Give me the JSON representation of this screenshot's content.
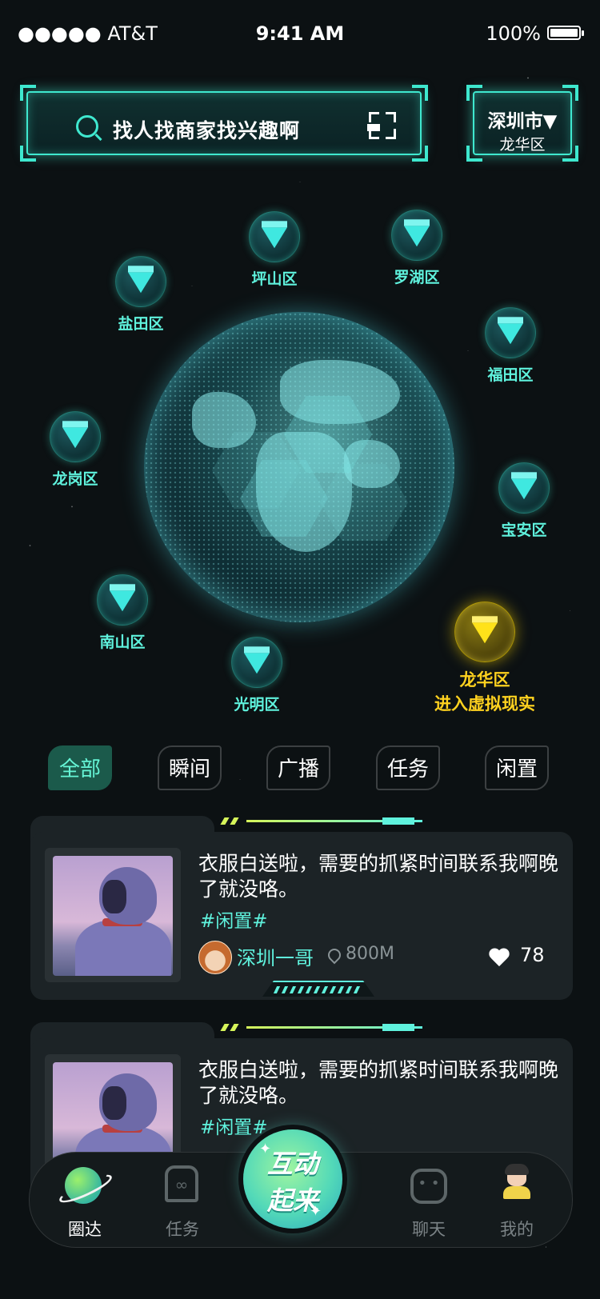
{
  "status_bar": {
    "carrier": "●●●●● AT&T",
    "time": "9:41 AM",
    "battery": "100%",
    "battery_level": 1.0
  },
  "search": {
    "placeholder": "找人找商家找兴趣啊"
  },
  "location": {
    "city": "深圳市▼",
    "district": "龙华区"
  },
  "districts": [
    {
      "name": "盐田区"
    },
    {
      "name": "坪山区"
    },
    {
      "name": "罗湖区"
    },
    {
      "name": "福田区"
    },
    {
      "name": "龙岗区"
    },
    {
      "name": "宝安区"
    },
    {
      "name": "南山区"
    },
    {
      "name": "光明区"
    }
  ],
  "active_district": {
    "name": "龙华区",
    "action": "进入虚拟现实"
  },
  "tabs": [
    {
      "label": "全部",
      "active": true
    },
    {
      "label": "瞬间"
    },
    {
      "label": "广播"
    },
    {
      "label": "任务"
    },
    {
      "label": "闲置"
    }
  ],
  "posts": [
    {
      "title": "衣服白送啦，需要的抓紧时间联系我啊晚了就没咯。",
      "tag": "#闲置#",
      "author": "深圳一哥",
      "distance": "800M",
      "likes": "78"
    },
    {
      "title": "衣服白送啦，需要的抓紧时间联系我啊晚了就没咯。",
      "tag": "#闲置#"
    }
  ],
  "nav": {
    "items": [
      {
        "label": "圈达",
        "icon": "planet-icon",
        "active": true
      },
      {
        "label": "任务",
        "icon": "task-icon"
      },
      {
        "label": "聊天",
        "icon": "chat-icon"
      },
      {
        "label": "我的",
        "icon": "avatar-icon"
      }
    ],
    "center": {
      "line1": "互动",
      "line2": "起来"
    }
  },
  "colors": {
    "accent": "#3fe8cf",
    "active_marker": "#ffd21f",
    "background": "#0c1113"
  }
}
